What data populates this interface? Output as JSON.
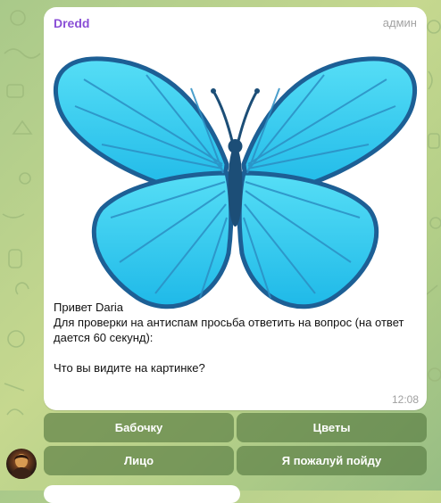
{
  "message": {
    "sender": "Dredd",
    "role": "админ",
    "lines": [
      "Привет Daria",
      "Для проверки на антиспам просьба ответить на вопрос (на ответ дается 60 секунд):",
      "",
      "Что вы видите на картинке?"
    ],
    "time": "12:08",
    "image_icon": "butterfly-image"
  },
  "keyboard": {
    "buttons": [
      "Бабочку",
      "Цветы",
      "Лицо",
      "Я пожалуй пойду"
    ]
  },
  "colors": {
    "sender": "#8a4fd6",
    "button_bg": "#53763e",
    "wing_light": "#4fd6f3",
    "wing_dark": "#1d5f95"
  }
}
